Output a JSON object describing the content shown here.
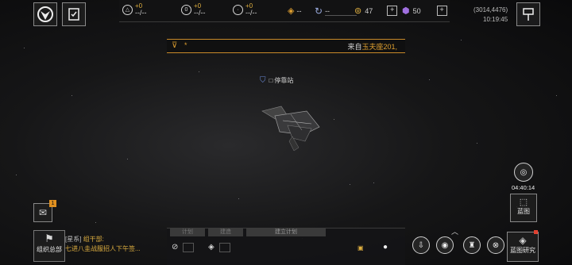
{
  "topbar": {
    "res1": {
      "up": "+0",
      "val": "--/--"
    },
    "res2": {
      "up": "+0",
      "val": "--/--"
    },
    "res3": {
      "up": "+0",
      "val": "--/--"
    },
    "res4": {
      "val": "--"
    },
    "res5": {
      "val": "--"
    },
    "res6": {
      "val": "47"
    },
    "res7": {
      "val": "50"
    }
  },
  "coords": {
    "position": "(3014,4476)",
    "time": "10:19:45"
  },
  "notice": {
    "marker": "*",
    "prefix": "来自",
    "source": "玉夫座201,"
  },
  "station": {
    "label": "停靠站"
  },
  "timer": {
    "value": "04:40:14"
  },
  "blueprint": {
    "label": "蓝图"
  },
  "blueprint_research": {
    "label": "蓝图研究"
  },
  "mail": {
    "badge": "1"
  },
  "org": {
    "label": "组织总部"
  },
  "chat": {
    "channel": "[星系]",
    "sender": "组干部:",
    "message": "七进八圭战服招人下午签..."
  },
  "bottom_tabs": {
    "tab1": "计划",
    "tab2": "建造",
    "tab3": "建立计划"
  },
  "colors": {
    "accent": "#e0a030",
    "purple": "#a070e0",
    "text": "#d8d8d8"
  }
}
